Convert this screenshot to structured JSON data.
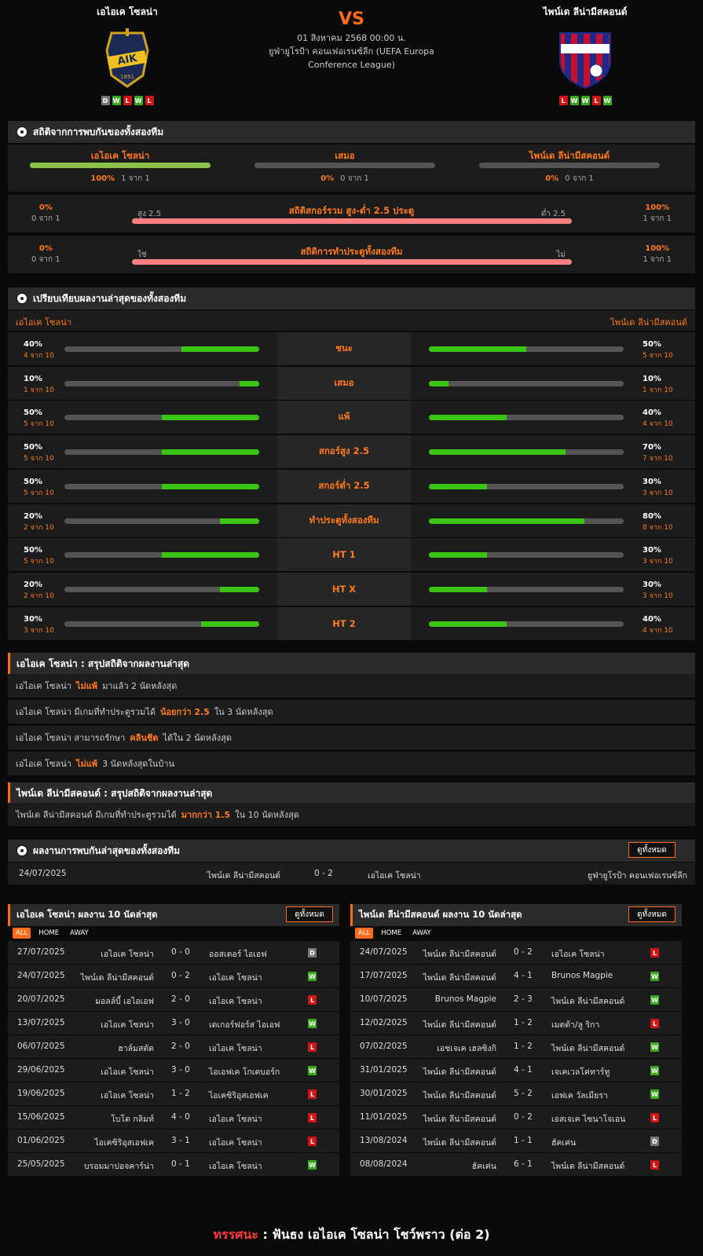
{
  "header": {
    "home": "เอไอเค โซลน่า",
    "away": "ไพน์เด ลีน่ามีสคอนด์",
    "vs": "VS",
    "date": "01 สิงหาคม 2568 00:00 น.",
    "league_line1": "ยูฟ่ายูโรป้า คอนเฟอเรนซ์ลีก (UEFA Europa",
    "league_line2": "Conference League)",
    "home_form": [
      "D",
      "W",
      "L",
      "W",
      "L"
    ],
    "away_form": [
      "L",
      "W",
      "W",
      "L",
      "W"
    ],
    "home_logo_text": "1891"
  },
  "h2h_section": {
    "title": "สถิติจากการพบกันของทั้งสองทีม",
    "cols": [
      {
        "label": "เอไอเค โซลน่า",
        "pct": "100%",
        "of": "1 จาก 1",
        "fill": 100
      },
      {
        "label": "เสมอ",
        "pct": "0%",
        "of": "0 จาก 1",
        "fill": 0
      },
      {
        "label": "ไพน์เด ลีน่ามีสคอนด์",
        "pct": "0%",
        "of": "0 จาก 1",
        "fill": 0
      }
    ],
    "ou": {
      "title": "สถิติสกอร์รวม สูง-ต่ำ 2.5 ประตู",
      "left_pct": "0%",
      "left_of": "0 จาก 1",
      "right_pct": "100%",
      "right_of": "1 จาก 1",
      "left_label": "สูง 2.5",
      "right_label": "ต่ำ 2.5"
    },
    "btts": {
      "title": "สถิติการทำประตูทั้งสองทีม",
      "left_pct": "0%",
      "left_of": "0 จาก 1",
      "right_pct": "100%",
      "right_of": "1 จาก 1",
      "left_label": "ใช่",
      "right_label": "ไม่"
    }
  },
  "compare": {
    "title": "เปรียบเทียบผลงานล่าสุดของทั้งสองทีม",
    "home": "เอไอเค โซลน่า",
    "away": "ไพน์เด ลีน่ามีสคอนด์",
    "rows": [
      {
        "label": "ชนะ",
        "hp": "40%",
        "ho": "4 จาก 10",
        "hf": 40,
        "ap": "50%",
        "ao": "5 จาก 10",
        "af": 50
      },
      {
        "label": "เสมอ",
        "hp": "10%",
        "ho": "1 จาก 10",
        "hf": 10,
        "ap": "10%",
        "ao": "1 จาก 10",
        "af": 10
      },
      {
        "label": "แพ้",
        "hp": "50%",
        "ho": "5 จาก 10",
        "hf": 50,
        "ap": "40%",
        "ao": "4 จาก 10",
        "af": 40
      },
      {
        "label": "สกอร์สูง 2.5",
        "hp": "50%",
        "ho": "5 จาก 10",
        "hf": 50,
        "ap": "70%",
        "ao": "7 จาก 10",
        "af": 70
      },
      {
        "label": "สกอร์ต่ำ 2.5",
        "hp": "50%",
        "ho": "5 จาก 10",
        "hf": 50,
        "ap": "30%",
        "ao": "3 จาก 10",
        "af": 30
      },
      {
        "label": "ทำประตูทั้งสองทีม",
        "hp": "20%",
        "ho": "2 จาก 10",
        "hf": 20,
        "ap": "80%",
        "ao": "8 จาก 10",
        "af": 80
      },
      {
        "label": "HT 1",
        "hp": "50%",
        "ho": "5 จาก 10",
        "hf": 50,
        "ap": "30%",
        "ao": "3 จาก 10",
        "af": 30
      },
      {
        "label": "HT X",
        "hp": "20%",
        "ho": "2 จาก 10",
        "hf": 20,
        "ap": "30%",
        "ao": "3 จาก 10",
        "af": 30
      },
      {
        "label": "HT 2",
        "hp": "30%",
        "ho": "3 จาก 10",
        "hf": 30,
        "ap": "40%",
        "ao": "4 จาก 10",
        "af": 40
      }
    ]
  },
  "home_summary": {
    "title": "เอไอเค โซลน่า : สรุปสถิติจากผลงานล่าสุด",
    "rows": [
      {
        "a": "เอไอเค โซลน่า",
        "b": "ไม่แพ้",
        "c": "มาแล้ว 2 นัดหลังสุด"
      },
      {
        "a": "เอไอเค โซลน่า  มีเกมที่ทำประตูรวมได้",
        "b": "น้อยกว่า  2.5",
        "c": "ใน 3 นัดหลังสุด"
      },
      {
        "a": "เอไอเค โซลน่า  สามารถรักษา",
        "b": "คลีนชีต",
        "c": "ได้ใน 2 นัดหลังสุด"
      },
      {
        "a": "เอไอเค โซลน่า",
        "b": "ไม่แพ้",
        "c": "3  นัดหลังสุดในบ้าน"
      }
    ]
  },
  "away_summary": {
    "title": "ไพน์เด ลีน่ามีสคอนด์ : สรุปสถิติจากผลงานล่าสุด",
    "rows": [
      {
        "a": "ไพน์เด ลีน่ามีสคอนด์  มีเกมที่ทำประตูรวมได้",
        "b": "มากกว่า  1.5",
        "c": "ใน 10 นัดหลังสุด"
      }
    ]
  },
  "h2h_results": {
    "title": "ผลงานการพบกันล่าสุดของทั้งสองทีม",
    "btn": "ดูทั้งหมด",
    "date": "24/07/2025",
    "home": "ไพน์เด ลีน่ามีสคอนด์",
    "score": "0 - 2",
    "away": "เอไอเค โซลน่า",
    "league": "ยูฟ่ายูโรป้า คอนเฟอเรนซ์ลีก"
  },
  "home_last": {
    "title": "เอไอเค โซลน่า ผลงาน 10 นัดล่าสุด",
    "btn": "ดูทั้งหมด",
    "tabs": [
      "ALL",
      "HOME",
      "AWAY"
    ],
    "rows": [
      {
        "d": "27/07/2025",
        "h": "เอไอเค โซลน่า",
        "s": "0 - 0",
        "a": "ออสเตอร์ ไอเอฟ",
        "r": "D"
      },
      {
        "d": "24/07/2025",
        "h": "ไพน์เด ลีน่ามีสคอนด์",
        "s": "0 - 2",
        "a": "เอไอเค โซลน่า",
        "r": "W"
      },
      {
        "d": "20/07/2025",
        "h": "มอลล์บี้ เอไอเอฟ",
        "s": "2 - 0",
        "a": "เอไอเค โซลน่า",
        "r": "L"
      },
      {
        "d": "13/07/2025",
        "h": "เอไอเค โซลน่า",
        "s": "3 - 0",
        "a": "เดเกอร์ฟอร์ส ไอเอฟ",
        "r": "W"
      },
      {
        "d": "06/07/2025",
        "h": "ฮาล์มสตัด",
        "s": "2 - 0",
        "a": "เอไอเค โซลน่า",
        "r": "L"
      },
      {
        "d": "29/06/2025",
        "h": "เอไอเค โซลน่า",
        "s": "3 - 0",
        "a": "ไอเอฟเค โกเตบอร์ก",
        "r": "W"
      },
      {
        "d": "19/06/2025",
        "h": "เอไอเค โซลน่า",
        "s": "1 - 2",
        "a": "ไอเคซิริอุสเอฟเค",
        "r": "L"
      },
      {
        "d": "15/06/2025",
        "h": "โบโด กลิมท์",
        "s": "4 - 0",
        "a": "เอไอเค โซลน่า",
        "r": "L"
      },
      {
        "d": "01/06/2025",
        "h": "ไอเคซิริอุสเอฟเค",
        "s": "3 - 1",
        "a": "เอไอเค โซลน่า",
        "r": "L"
      },
      {
        "d": "25/05/2025",
        "h": "บรอมมาปอจคาร์น่า",
        "s": "0 - 1",
        "a": "เอไอเค โซลน่า",
        "r": "W"
      }
    ]
  },
  "away_last": {
    "title": "ไพน์เด ลีน่ามีสคอนด์ ผลงาน 10 นัดล่าสุด",
    "btn": "ดูทั้งหมด",
    "tabs": [
      "ALL",
      "HOME",
      "AWAY"
    ],
    "rows": [
      {
        "d": "24/07/2025",
        "h": "ไพน์เด ลีน่ามีสคอนด์",
        "s": "0 - 2",
        "a": "เอไอเค โซลน่า",
        "r": "L"
      },
      {
        "d": "17/07/2025",
        "h": "ไพน์เด ลีน่ามีสคอนด์",
        "s": "4 - 1",
        "a": "Brunos Magpie",
        "r": "W"
      },
      {
        "d": "10/07/2025",
        "h": "Brunos Magpie",
        "s": "2 - 3",
        "a": "ไพน์เด ลีน่ามีสคอนด์",
        "r": "W"
      },
      {
        "d": "12/02/2025",
        "h": "ไพน์เด ลีน่ามีสคอนด์",
        "s": "1 - 2",
        "a": "เมตต้า/ลู ริกา",
        "r": "L"
      },
      {
        "d": "07/02/2025",
        "h": "เอชเจเค เฮลซิงกิ",
        "s": "1 - 2",
        "a": "ไพน์เด ลีน่ามีสคอนด์",
        "r": "W"
      },
      {
        "d": "31/01/2025",
        "h": "ไพน์เด ลีน่ามีสคอนด์",
        "s": "4 - 1",
        "a": "เจเคเวลโค่ทาร์ทู",
        "r": "W"
      },
      {
        "d": "30/01/2025",
        "h": "ไพน์เด ลีน่ามีสคอนด์",
        "s": "5 - 2",
        "a": "เอฟเค วัลเมียรา",
        "r": "W"
      },
      {
        "d": "11/01/2025",
        "h": "ไพน์เด ลีน่ามีสคอนด์",
        "s": "0 - 2",
        "a": "เอสเจเค ไซนาโจเอน",
        "r": "L"
      },
      {
        "d": "13/08/2024",
        "h": "ไพน์เด ลีน่ามีสคอนด์",
        "s": "1 - 1",
        "a": "ฮัคเค่น",
        "r": "D"
      },
      {
        "d": "08/08/2024",
        "h": "ฮัคเค่น",
        "s": "6 - 1",
        "a": "ไพน์เด ลีน่ามีสคอนด์",
        "r": "L"
      }
    ]
  },
  "footer": {
    "k": "ทรรศนะ",
    "sep": " :  ",
    "text": "ฟันธง เอไอเค โซลน่า โชว์พราว (ต่อ 2)"
  },
  "colors": {
    "accent": "#ff6b1a",
    "win": "#3aa91b",
    "loss": "#d41414",
    "draw": "#777777",
    "bar_green": "#3ac414"
  }
}
